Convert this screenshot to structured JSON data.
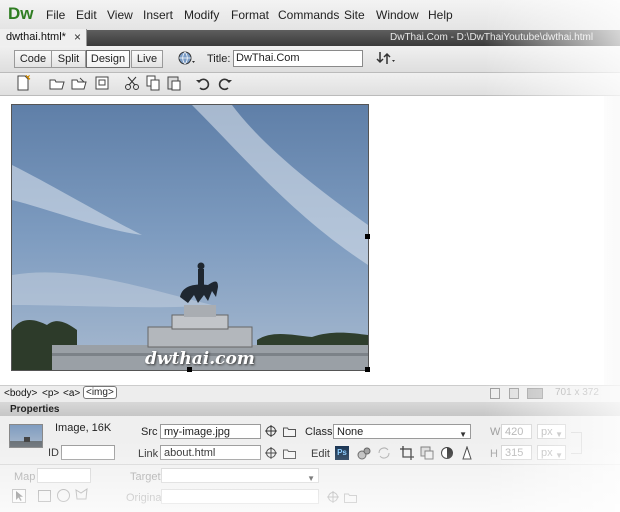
{
  "app": {
    "logo": "Dw",
    "menu": [
      "File",
      "Edit",
      "View",
      "Insert",
      "Modify",
      "Format",
      "Commands",
      "Site",
      "Window",
      "Help"
    ]
  },
  "doc_tab": {
    "label": "dwthai.html*",
    "close": "×",
    "path": "DwThai.Com - D:\\DwThaiYoutube\\dwthai.html"
  },
  "view_buttons": {
    "code": "Code",
    "split": "Split",
    "design": "Design",
    "live": "Live"
  },
  "title_field": {
    "label": "Title:",
    "value": "DwThai.Com"
  },
  "watermark": "dwthai.com",
  "tag_selector": {
    "body": "<body>",
    "p": "<p>",
    "a": "<a>",
    "img": "<img>",
    "size": "701 x 372"
  },
  "properties": {
    "header": "Properties",
    "image_info": "Image, 16K",
    "id_label": "ID",
    "id_value": "",
    "src_label": "Src",
    "src_value": "my-image.jpg",
    "link_label": "Link",
    "link_value": "about.html",
    "class_label": "Class",
    "class_value": "None",
    "edit_label": "Edit",
    "w_label": "W",
    "w_value": "420",
    "h_label": "H",
    "h_value": "315",
    "unit_w": "px",
    "unit_h": "px",
    "map_label": "Map",
    "target_label": "Target",
    "original_label": "Original",
    "ps_badge": "Ps"
  },
  "colors": {
    "logo": "#2f7d22",
    "tabbar": "#4a4a4a",
    "panel": "#efefef"
  }
}
